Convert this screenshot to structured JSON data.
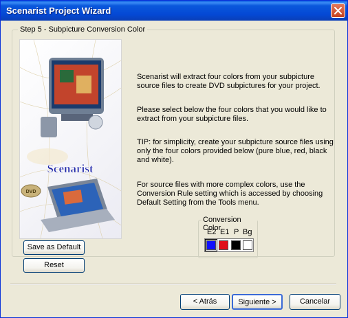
{
  "window": {
    "title": "Scenarist Project Wizard"
  },
  "step": {
    "label": "Step 5  -  Subpicture Conversion Color"
  },
  "picture": {
    "brand": "Scenarist",
    "badge": "DVD"
  },
  "paragraphs": [
    "Scenarist will extract four colors from your subpicture source files to create DVD subpictures for your project.",
    "Please select below the four colors that you would like to extract from your subpicture files.",
    "TIP: for simplicity, create your subpicture source files using only the four colors provided below (pure blue, red, black and white).",
    "For source files with more complex colors, use the Conversion Rule setting which is accessed by choosing Default Setting from the Tools menu."
  ],
  "conversion_color": {
    "legend": "Conversion Color",
    "labels": [
      "E2",
      "E1",
      "P",
      "Bg"
    ],
    "colors": [
      "#1010ff",
      "#e0101a",
      "#000000",
      "#ffffff"
    ]
  },
  "buttons": {
    "save_default": "Save as Default",
    "reset": "Reset",
    "back": "< Atrás",
    "next": "Siguiente >",
    "cancel": "Cancelar"
  }
}
